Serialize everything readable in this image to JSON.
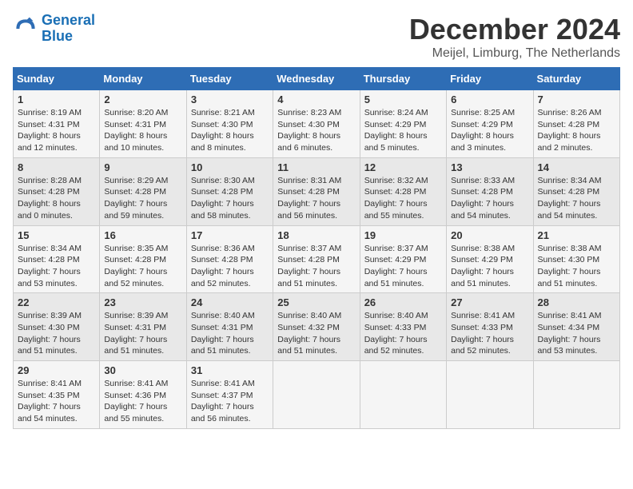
{
  "header": {
    "logo_line1": "General",
    "logo_line2": "Blue",
    "month_title": "December 2024",
    "location": "Meijel, Limburg, The Netherlands"
  },
  "days_of_week": [
    "Sunday",
    "Monday",
    "Tuesday",
    "Wednesday",
    "Thursday",
    "Friday",
    "Saturday"
  ],
  "weeks": [
    [
      {
        "day": "1",
        "info": "Sunrise: 8:19 AM\nSunset: 4:31 PM\nDaylight: 8 hours\nand 12 minutes."
      },
      {
        "day": "2",
        "info": "Sunrise: 8:20 AM\nSunset: 4:31 PM\nDaylight: 8 hours\nand 10 minutes."
      },
      {
        "day": "3",
        "info": "Sunrise: 8:21 AM\nSunset: 4:30 PM\nDaylight: 8 hours\nand 8 minutes."
      },
      {
        "day": "4",
        "info": "Sunrise: 8:23 AM\nSunset: 4:30 PM\nDaylight: 8 hours\nand 6 minutes."
      },
      {
        "day": "5",
        "info": "Sunrise: 8:24 AM\nSunset: 4:29 PM\nDaylight: 8 hours\nand 5 minutes."
      },
      {
        "day": "6",
        "info": "Sunrise: 8:25 AM\nSunset: 4:29 PM\nDaylight: 8 hours\nand 3 minutes."
      },
      {
        "day": "7",
        "info": "Sunrise: 8:26 AM\nSunset: 4:28 PM\nDaylight: 8 hours\nand 2 minutes."
      }
    ],
    [
      {
        "day": "8",
        "info": "Sunrise: 8:28 AM\nSunset: 4:28 PM\nDaylight: 8 hours\nand 0 minutes."
      },
      {
        "day": "9",
        "info": "Sunrise: 8:29 AM\nSunset: 4:28 PM\nDaylight: 7 hours\nand 59 minutes."
      },
      {
        "day": "10",
        "info": "Sunrise: 8:30 AM\nSunset: 4:28 PM\nDaylight: 7 hours\nand 58 minutes."
      },
      {
        "day": "11",
        "info": "Sunrise: 8:31 AM\nSunset: 4:28 PM\nDaylight: 7 hours\nand 56 minutes."
      },
      {
        "day": "12",
        "info": "Sunrise: 8:32 AM\nSunset: 4:28 PM\nDaylight: 7 hours\nand 55 minutes."
      },
      {
        "day": "13",
        "info": "Sunrise: 8:33 AM\nSunset: 4:28 PM\nDaylight: 7 hours\nand 54 minutes."
      },
      {
        "day": "14",
        "info": "Sunrise: 8:34 AM\nSunset: 4:28 PM\nDaylight: 7 hours\nand 54 minutes."
      }
    ],
    [
      {
        "day": "15",
        "info": "Sunrise: 8:34 AM\nSunset: 4:28 PM\nDaylight: 7 hours\nand 53 minutes."
      },
      {
        "day": "16",
        "info": "Sunrise: 8:35 AM\nSunset: 4:28 PM\nDaylight: 7 hours\nand 52 minutes."
      },
      {
        "day": "17",
        "info": "Sunrise: 8:36 AM\nSunset: 4:28 PM\nDaylight: 7 hours\nand 52 minutes."
      },
      {
        "day": "18",
        "info": "Sunrise: 8:37 AM\nSunset: 4:28 PM\nDaylight: 7 hours\nand 51 minutes."
      },
      {
        "day": "19",
        "info": "Sunrise: 8:37 AM\nSunset: 4:29 PM\nDaylight: 7 hours\nand 51 minutes."
      },
      {
        "day": "20",
        "info": "Sunrise: 8:38 AM\nSunset: 4:29 PM\nDaylight: 7 hours\nand 51 minutes."
      },
      {
        "day": "21",
        "info": "Sunrise: 8:38 AM\nSunset: 4:30 PM\nDaylight: 7 hours\nand 51 minutes."
      }
    ],
    [
      {
        "day": "22",
        "info": "Sunrise: 8:39 AM\nSunset: 4:30 PM\nDaylight: 7 hours\nand 51 minutes."
      },
      {
        "day": "23",
        "info": "Sunrise: 8:39 AM\nSunset: 4:31 PM\nDaylight: 7 hours\nand 51 minutes."
      },
      {
        "day": "24",
        "info": "Sunrise: 8:40 AM\nSunset: 4:31 PM\nDaylight: 7 hours\nand 51 minutes."
      },
      {
        "day": "25",
        "info": "Sunrise: 8:40 AM\nSunset: 4:32 PM\nDaylight: 7 hours\nand 51 minutes."
      },
      {
        "day": "26",
        "info": "Sunrise: 8:40 AM\nSunset: 4:33 PM\nDaylight: 7 hours\nand 52 minutes."
      },
      {
        "day": "27",
        "info": "Sunrise: 8:41 AM\nSunset: 4:33 PM\nDaylight: 7 hours\nand 52 minutes."
      },
      {
        "day": "28",
        "info": "Sunrise: 8:41 AM\nSunset: 4:34 PM\nDaylight: 7 hours\nand 53 minutes."
      }
    ],
    [
      {
        "day": "29",
        "info": "Sunrise: 8:41 AM\nSunset: 4:35 PM\nDaylight: 7 hours\nand 54 minutes."
      },
      {
        "day": "30",
        "info": "Sunrise: 8:41 AM\nSunset: 4:36 PM\nDaylight: 7 hours\nand 55 minutes."
      },
      {
        "day": "31",
        "info": "Sunrise: 8:41 AM\nSunset: 4:37 PM\nDaylight: 7 hours\nand 56 minutes."
      },
      {
        "day": "",
        "info": ""
      },
      {
        "day": "",
        "info": ""
      },
      {
        "day": "",
        "info": ""
      },
      {
        "day": "",
        "info": ""
      }
    ]
  ]
}
